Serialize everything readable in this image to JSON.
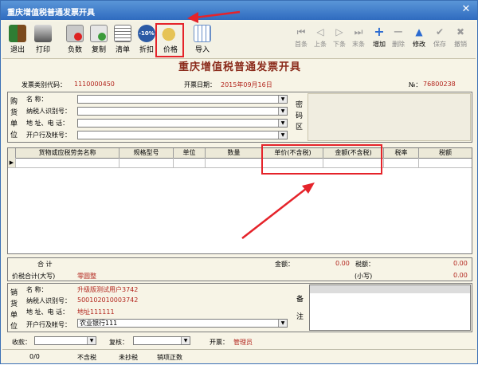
{
  "window": {
    "title": "重庆增值税普通发票开具"
  },
  "toolbar": {
    "left": [
      {
        "label": "退出",
        "icon": "exit-icon"
      },
      {
        "label": "打印",
        "icon": "printer-icon"
      },
      {
        "label": "负数",
        "icon": "negative-icon"
      },
      {
        "label": "复制",
        "icon": "copy-icon"
      },
      {
        "label": "清单",
        "icon": "list-icon"
      },
      {
        "label": "折扣",
        "icon": "discount-icon",
        "badge": "-10%"
      },
      {
        "label": "价格",
        "icon": "price-tag-icon"
      },
      {
        "label": "导入",
        "icon": "import-icon"
      }
    ],
    "right": [
      {
        "label": "首条"
      },
      {
        "label": "上条"
      },
      {
        "label": "下条"
      },
      {
        "label": "末条"
      },
      {
        "label": "增加"
      },
      {
        "label": "删除"
      },
      {
        "label": "修改"
      },
      {
        "label": "保存"
      },
      {
        "label": "撤销"
      }
    ]
  },
  "invoice": {
    "heading": "重庆增值税普通发票开具",
    "code_label": "发票类别代码：",
    "code_value": "1110000450",
    "date_label": "开票日期：",
    "date_value": "2015年09月16日",
    "no_label": "№：",
    "no_value": "76800238"
  },
  "buyer": {
    "section": "购货单位",
    "fields": [
      {
        "label": "名        称："
      },
      {
        "label": "纳税人识别号："
      },
      {
        "label": "地 址、电 话："
      },
      {
        "label": "开户行及帐号："
      }
    ],
    "code_area": "密码区"
  },
  "table": {
    "headers": [
      "货物或应税劳务名称",
      "规格型号",
      "单位",
      "数量",
      "单价(不含税)",
      "金额(不含税)",
      "税率",
      "税额"
    ]
  },
  "totals": {
    "sum_label": "合        计",
    "amount_label": "金额：",
    "amount_value": "0.00",
    "tax_label": "税额：",
    "tax_value": "0.00",
    "cap_label": "价税合计(大写)",
    "cap_value": "零圆整",
    "small_label": "(小写)",
    "small_value": "0.00"
  },
  "seller": {
    "section": "销货单位",
    "name_label": "名        称：",
    "name_value": "升级版测试用户3742",
    "tax_label": "纳税人识别号：",
    "tax_value": "500102010003742",
    "addr_label": "地 址、电 话：",
    "addr_value": "地址111111",
    "bank_label": "开户行及帐号：",
    "bank_value": "农业银行111",
    "remarks": "备注"
  },
  "signers": {
    "payee_label": "收款：",
    "review_label": "复核：",
    "drawer_label": "开票：",
    "drawer_value": "管理员"
  },
  "status": {
    "count": "0/0",
    "s1": "不含税",
    "s2": "未抄税",
    "s3": "销项正数"
  },
  "colors": {
    "accent": "#e5232a",
    "label_red": "#b3261e",
    "title_brown": "#8b2b1b",
    "titlebar": "#2f6bbf"
  }
}
